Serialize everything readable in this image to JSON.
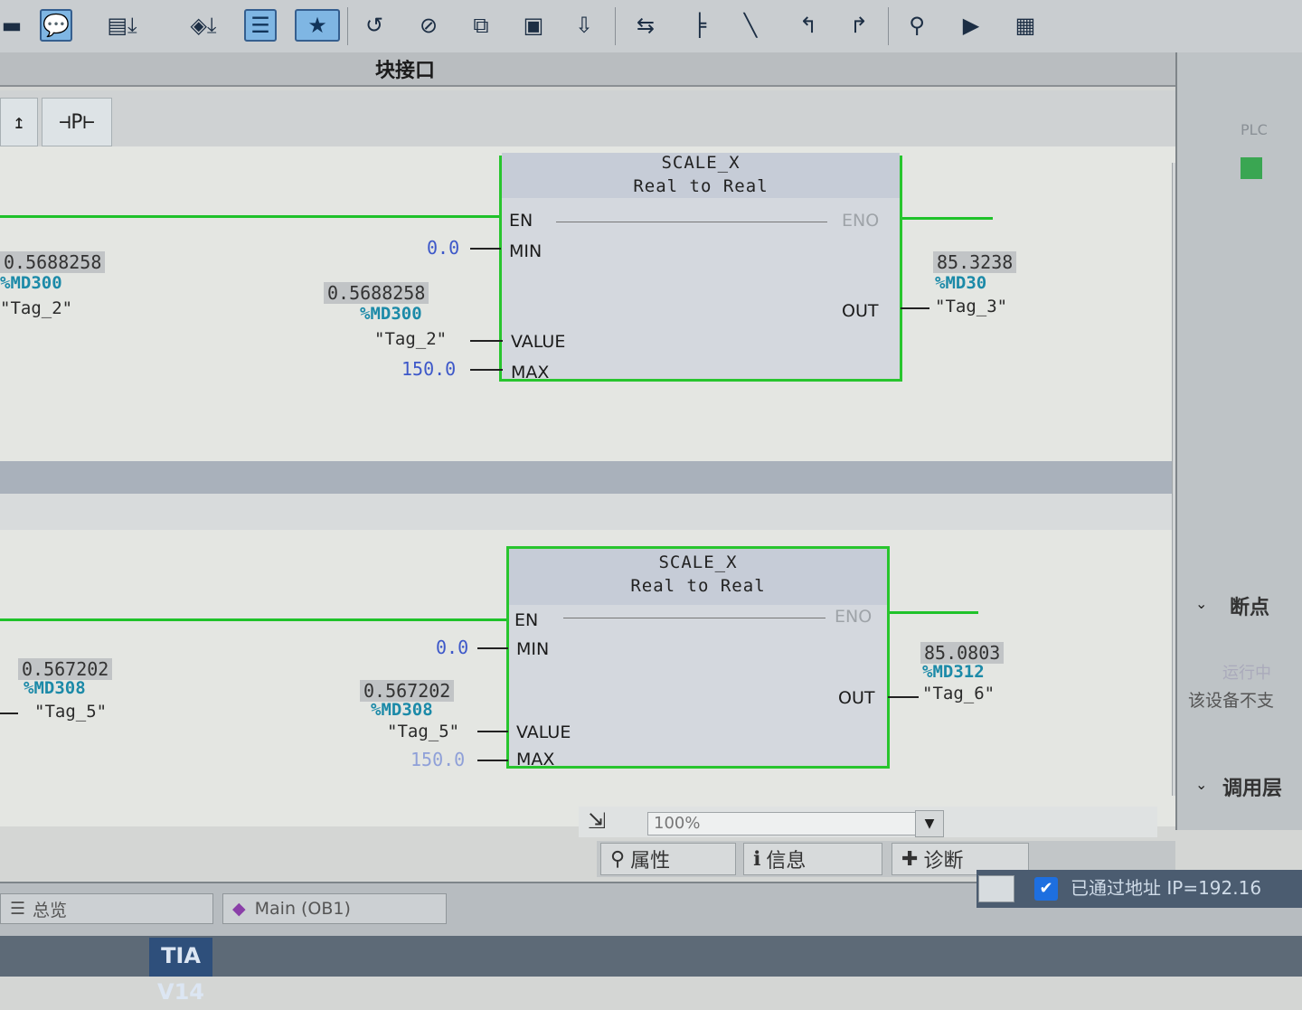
{
  "toolbar": {
    "icons": [
      "list-icon",
      "comment-icon",
      "download-icon-1",
      "download-icon-2",
      "table-icon",
      "favorites-icon",
      "go-online-icon",
      "monitor-off-icon",
      "compare-icon",
      "call-env-icon",
      "step-icon",
      "insert-network-icon",
      "network-add-icon",
      "network-branch-icon",
      "open-branch-icon",
      "close-branch-icon",
      "search-icon",
      "simulate-icon",
      "memory-icon"
    ]
  },
  "block_interface": {
    "label": "块接口"
  },
  "ladder_toolbar": {
    "contact_symbol": "⊣P⊢"
  },
  "network1": {
    "block": {
      "name": "SCALE_X",
      "type": "Real  to  Real"
    },
    "pins": {
      "en": "EN",
      "eno": "ENO",
      "min": "MIN",
      "value": "VALUE",
      "max": "MAX",
      "out": "OUT"
    },
    "min_const": "0.0",
    "max_const": "150.0",
    "left_monitor": {
      "value": "0.5688258",
      "address": "%MD300",
      "tag": "\"Tag_2\""
    },
    "value_input": {
      "value": "0.5688258",
      "address": "%MD300",
      "tag": "\"Tag_2\""
    },
    "out_output": {
      "value": "85.3238",
      "address": "%MD30",
      "tag": "\"Tag_3\""
    }
  },
  "network2": {
    "block": {
      "name": "SCALE_X",
      "type": "Real  to  Real"
    },
    "pins": {
      "en": "EN",
      "eno": "ENO",
      "min": "MIN",
      "value": "VALUE",
      "max": "MAX",
      "out": "OUT"
    },
    "min_const": "0.0",
    "max_const": "150.0",
    "left_monitor": {
      "value": "0.567202",
      "address": "%MD308",
      "tag": "\"Tag_5\""
    },
    "value_input": {
      "value": "0.567202",
      "address": "%MD308",
      "tag": "\"Tag_5\""
    },
    "out_output": {
      "value": "85.0803",
      "address": "%MD312",
      "tag": "\"Tag_6\""
    }
  },
  "zoom": {
    "value": "100%"
  },
  "inspector_tabs": [
    {
      "label": "属性",
      "icon": "properties-icon"
    },
    {
      "label": "信息",
      "icon": "info-icon"
    },
    {
      "label": "诊断",
      "icon": "diagnostics-icon"
    }
  ],
  "right_panel": {
    "breakpoints": "断点",
    "call_hierarchy": "调用层",
    "device_note": "该设备不支",
    "pending": "运行中",
    "plc": "PLC"
  },
  "taskbar": {
    "overview": "总览",
    "main_block": "Main (OB1)"
  },
  "status": {
    "text": "已通过地址 IP=192.16"
  },
  "tia": {
    "logo": "TIA V14"
  }
}
